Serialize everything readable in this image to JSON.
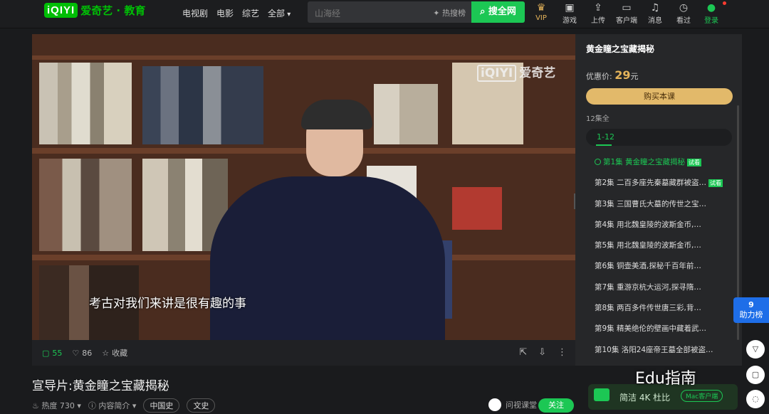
{
  "brand": {
    "logo": "iQIYI",
    "name": "爱奇艺 · 教育"
  },
  "nav": [
    "电视剧",
    "电影",
    "综艺",
    "全部"
  ],
  "search": {
    "placeholder": "山海经",
    "hot": "热搜榜",
    "button": "搜全网"
  },
  "top_icons": [
    {
      "label": "VIP",
      "icon": "crown-icon"
    },
    {
      "label": "游戏",
      "icon": "gamepad-icon"
    },
    {
      "label": "上传",
      "icon": "upload-icon"
    },
    {
      "label": "客户端",
      "icon": "monitor-icon"
    },
    {
      "label": "消息",
      "icon": "bell-icon"
    },
    {
      "label": "看过",
      "icon": "clock-icon"
    },
    {
      "label": "登录",
      "icon": "user-icon"
    }
  ],
  "player": {
    "watermark_brand": "iQIYI",
    "watermark": "爱奇艺",
    "subtitle": "考古对我们来讲是很有趣的事"
  },
  "player_bar": {
    "comments": "55",
    "likes": "86",
    "collect": "收藏"
  },
  "panel": {
    "title": "黄金瞳之宝藏揭秘",
    "price_label": "优惠价:",
    "price": "29",
    "price_unit": "元",
    "buy": "购买本课",
    "count": "12集全",
    "range": "1-12",
    "episodes": [
      {
        "title": "第1集  黄金瞳之宝藏揭秘",
        "badge": "试看"
      },
      {
        "title": "第2集  二百多座先秦墓藏群被盗…",
        "badge": "试看"
      },
      {
        "title": "第3集  三国曹氏大墓的传世之宝…",
        "badge": ""
      },
      {
        "title": "第4集  用北魏皇陵的波斯金币,…",
        "badge": ""
      },
      {
        "title": "第5集  用北魏皇陵的波斯金币,…",
        "badge": ""
      },
      {
        "title": "第6集  铜壶美酒,探秘千百年前…",
        "badge": ""
      },
      {
        "title": "第7集  重游京杭大运河,探寻隋…",
        "badge": ""
      },
      {
        "title": "第8集  两百多件传世唐三彩,背…",
        "badge": ""
      },
      {
        "title": "第9集  精美绝伦的壁画中藏着武…",
        "badge": ""
      },
      {
        "title": "第10集  洛阳24座帝王墓全部被盗…",
        "badge": ""
      }
    ]
  },
  "video": {
    "title": "宣导片:黄金瞳之宝藏揭秘",
    "heat_label": "热度",
    "heat": "730",
    "intro": "内容简介",
    "tags": [
      "中国史",
      "文史"
    ],
    "author": "问视课堂",
    "follow": "关注"
  },
  "promo": {
    "text": "简洁 4K 杜比",
    "button": "Mac客户端"
  },
  "overlay": {
    "watermark": "Edu指南",
    "help": "助力榜",
    "help_top": "9"
  }
}
